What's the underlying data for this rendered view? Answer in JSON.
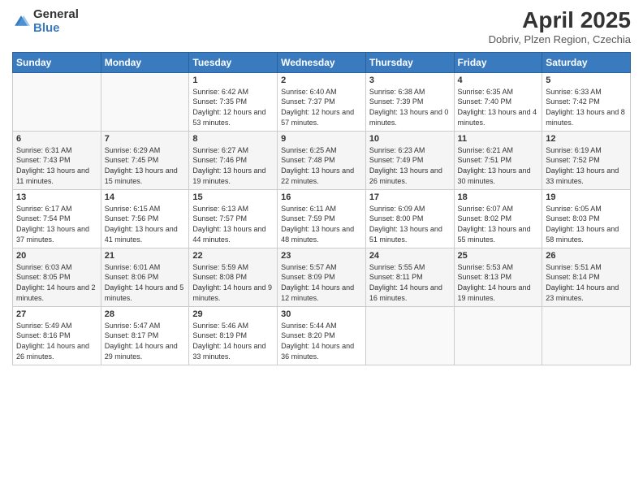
{
  "header": {
    "logo_general": "General",
    "logo_blue": "Blue",
    "main_title": "April 2025",
    "subtitle": "Dobriv, Plzen Region, Czechia"
  },
  "weekdays": [
    "Sunday",
    "Monday",
    "Tuesday",
    "Wednesday",
    "Thursday",
    "Friday",
    "Saturday"
  ],
  "weeks": [
    [
      {
        "day": "",
        "sunrise": "",
        "sunset": "",
        "daylight": ""
      },
      {
        "day": "",
        "sunrise": "",
        "sunset": "",
        "daylight": ""
      },
      {
        "day": "1",
        "sunrise": "Sunrise: 6:42 AM",
        "sunset": "Sunset: 7:35 PM",
        "daylight": "Daylight: 12 hours and 53 minutes."
      },
      {
        "day": "2",
        "sunrise": "Sunrise: 6:40 AM",
        "sunset": "Sunset: 7:37 PM",
        "daylight": "Daylight: 12 hours and 57 minutes."
      },
      {
        "day": "3",
        "sunrise": "Sunrise: 6:38 AM",
        "sunset": "Sunset: 7:39 PM",
        "daylight": "Daylight: 13 hours and 0 minutes."
      },
      {
        "day": "4",
        "sunrise": "Sunrise: 6:35 AM",
        "sunset": "Sunset: 7:40 PM",
        "daylight": "Daylight: 13 hours and 4 minutes."
      },
      {
        "day": "5",
        "sunrise": "Sunrise: 6:33 AM",
        "sunset": "Sunset: 7:42 PM",
        "daylight": "Daylight: 13 hours and 8 minutes."
      }
    ],
    [
      {
        "day": "6",
        "sunrise": "Sunrise: 6:31 AM",
        "sunset": "Sunset: 7:43 PM",
        "daylight": "Daylight: 13 hours and 11 minutes."
      },
      {
        "day": "7",
        "sunrise": "Sunrise: 6:29 AM",
        "sunset": "Sunset: 7:45 PM",
        "daylight": "Daylight: 13 hours and 15 minutes."
      },
      {
        "day": "8",
        "sunrise": "Sunrise: 6:27 AM",
        "sunset": "Sunset: 7:46 PM",
        "daylight": "Daylight: 13 hours and 19 minutes."
      },
      {
        "day": "9",
        "sunrise": "Sunrise: 6:25 AM",
        "sunset": "Sunset: 7:48 PM",
        "daylight": "Daylight: 13 hours and 22 minutes."
      },
      {
        "day": "10",
        "sunrise": "Sunrise: 6:23 AM",
        "sunset": "Sunset: 7:49 PM",
        "daylight": "Daylight: 13 hours and 26 minutes."
      },
      {
        "day": "11",
        "sunrise": "Sunrise: 6:21 AM",
        "sunset": "Sunset: 7:51 PM",
        "daylight": "Daylight: 13 hours and 30 minutes."
      },
      {
        "day": "12",
        "sunrise": "Sunrise: 6:19 AM",
        "sunset": "Sunset: 7:52 PM",
        "daylight": "Daylight: 13 hours and 33 minutes."
      }
    ],
    [
      {
        "day": "13",
        "sunrise": "Sunrise: 6:17 AM",
        "sunset": "Sunset: 7:54 PM",
        "daylight": "Daylight: 13 hours and 37 minutes."
      },
      {
        "day": "14",
        "sunrise": "Sunrise: 6:15 AM",
        "sunset": "Sunset: 7:56 PM",
        "daylight": "Daylight: 13 hours and 41 minutes."
      },
      {
        "day": "15",
        "sunrise": "Sunrise: 6:13 AM",
        "sunset": "Sunset: 7:57 PM",
        "daylight": "Daylight: 13 hours and 44 minutes."
      },
      {
        "day": "16",
        "sunrise": "Sunrise: 6:11 AM",
        "sunset": "Sunset: 7:59 PM",
        "daylight": "Daylight: 13 hours and 48 minutes."
      },
      {
        "day": "17",
        "sunrise": "Sunrise: 6:09 AM",
        "sunset": "Sunset: 8:00 PM",
        "daylight": "Daylight: 13 hours and 51 minutes."
      },
      {
        "day": "18",
        "sunrise": "Sunrise: 6:07 AM",
        "sunset": "Sunset: 8:02 PM",
        "daylight": "Daylight: 13 hours and 55 minutes."
      },
      {
        "day": "19",
        "sunrise": "Sunrise: 6:05 AM",
        "sunset": "Sunset: 8:03 PM",
        "daylight": "Daylight: 13 hours and 58 minutes."
      }
    ],
    [
      {
        "day": "20",
        "sunrise": "Sunrise: 6:03 AM",
        "sunset": "Sunset: 8:05 PM",
        "daylight": "Daylight: 14 hours and 2 minutes."
      },
      {
        "day": "21",
        "sunrise": "Sunrise: 6:01 AM",
        "sunset": "Sunset: 8:06 PM",
        "daylight": "Daylight: 14 hours and 5 minutes."
      },
      {
        "day": "22",
        "sunrise": "Sunrise: 5:59 AM",
        "sunset": "Sunset: 8:08 PM",
        "daylight": "Daylight: 14 hours and 9 minutes."
      },
      {
        "day": "23",
        "sunrise": "Sunrise: 5:57 AM",
        "sunset": "Sunset: 8:09 PM",
        "daylight": "Daylight: 14 hours and 12 minutes."
      },
      {
        "day": "24",
        "sunrise": "Sunrise: 5:55 AM",
        "sunset": "Sunset: 8:11 PM",
        "daylight": "Daylight: 14 hours and 16 minutes."
      },
      {
        "day": "25",
        "sunrise": "Sunrise: 5:53 AM",
        "sunset": "Sunset: 8:13 PM",
        "daylight": "Daylight: 14 hours and 19 minutes."
      },
      {
        "day": "26",
        "sunrise": "Sunrise: 5:51 AM",
        "sunset": "Sunset: 8:14 PM",
        "daylight": "Daylight: 14 hours and 23 minutes."
      }
    ],
    [
      {
        "day": "27",
        "sunrise": "Sunrise: 5:49 AM",
        "sunset": "Sunset: 8:16 PM",
        "daylight": "Daylight: 14 hours and 26 minutes."
      },
      {
        "day": "28",
        "sunrise": "Sunrise: 5:47 AM",
        "sunset": "Sunset: 8:17 PM",
        "daylight": "Daylight: 14 hours and 29 minutes."
      },
      {
        "day": "29",
        "sunrise": "Sunrise: 5:46 AM",
        "sunset": "Sunset: 8:19 PM",
        "daylight": "Daylight: 14 hours and 33 minutes."
      },
      {
        "day": "30",
        "sunrise": "Sunrise: 5:44 AM",
        "sunset": "Sunset: 8:20 PM",
        "daylight": "Daylight: 14 hours and 36 minutes."
      },
      {
        "day": "",
        "sunrise": "",
        "sunset": "",
        "daylight": ""
      },
      {
        "day": "",
        "sunrise": "",
        "sunset": "",
        "daylight": ""
      },
      {
        "day": "",
        "sunrise": "",
        "sunset": "",
        "daylight": ""
      }
    ]
  ]
}
